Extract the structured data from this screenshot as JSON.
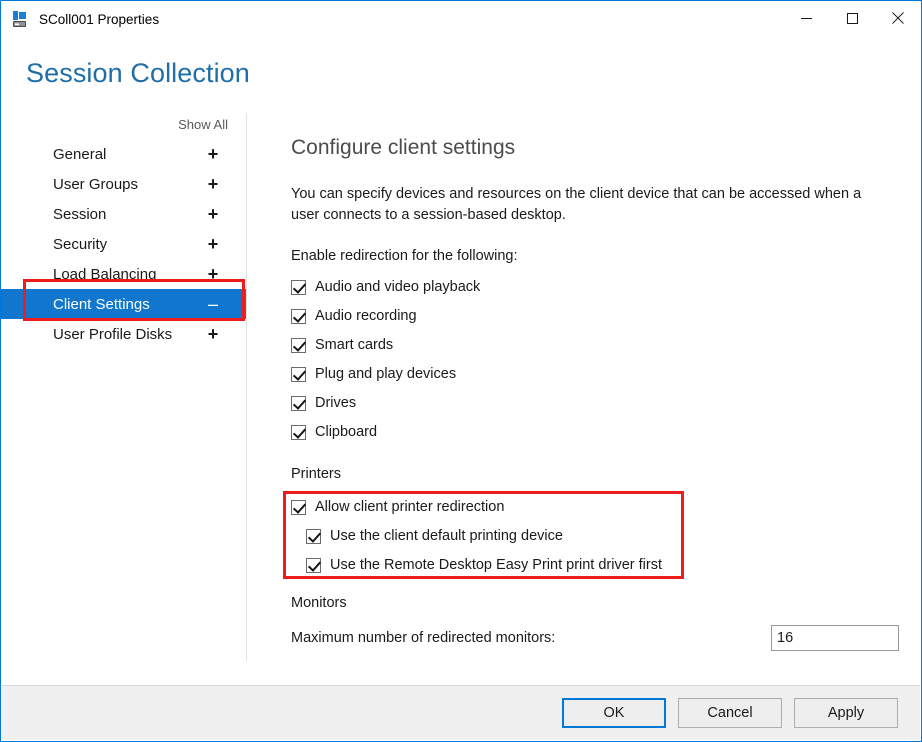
{
  "window": {
    "title": "SColl001 Properties",
    "icon": "session-collection-icon",
    "controls": {
      "minimize": "minimize-icon",
      "maximize": "maximize-icon",
      "close": "close-icon"
    }
  },
  "header": {
    "title": "Session Collection"
  },
  "sidebar": {
    "show_all": "Show All",
    "items": [
      {
        "label": "General",
        "sign": "+",
        "selected": false
      },
      {
        "label": "User Groups",
        "sign": "+",
        "selected": false
      },
      {
        "label": "Session",
        "sign": "+",
        "selected": false
      },
      {
        "label": "Security",
        "sign": "+",
        "selected": false
      },
      {
        "label": "Load Balancing",
        "sign": "+",
        "selected": false
      },
      {
        "label": "Client Settings",
        "sign": "–",
        "selected": true
      },
      {
        "label": "User Profile Disks",
        "sign": "+",
        "selected": false
      }
    ]
  },
  "main": {
    "title": "Configure client settings",
    "description": "You can specify devices and resources on the client device that can be accessed when a user connects to a session-based desktop.",
    "redirection_label": "Enable redirection for the following:",
    "redirection_options": [
      {
        "label": "Audio and video playback",
        "checked": true
      },
      {
        "label": "Audio recording",
        "checked": true
      },
      {
        "label": "Smart cards",
        "checked": true
      },
      {
        "label": "Plug and play devices",
        "checked": true
      },
      {
        "label": "Drives",
        "checked": true
      },
      {
        "label": "Clipboard",
        "checked": true
      }
    ],
    "printers": {
      "section_label": "Printers",
      "options": [
        {
          "label": "Allow client printer redirection",
          "checked": true,
          "sub": false
        },
        {
          "label": "Use the client default printing device",
          "checked": true,
          "sub": true
        },
        {
          "label": "Use the Remote Desktop Easy Print print driver first",
          "checked": true,
          "sub": true
        }
      ]
    },
    "monitors": {
      "section_label": "Monitors",
      "max_label": "Maximum number of redirected monitors:",
      "max_value": "16"
    }
  },
  "footer": {
    "ok": "OK",
    "cancel": "Cancel",
    "apply": "Apply"
  },
  "colors": {
    "accent_blue": "#0078d7",
    "selection_blue": "#1076ce",
    "header_blue": "#1e6ea7",
    "highlight_red": "#ee1c1c",
    "footer_gray": "#f0f0f0"
  }
}
